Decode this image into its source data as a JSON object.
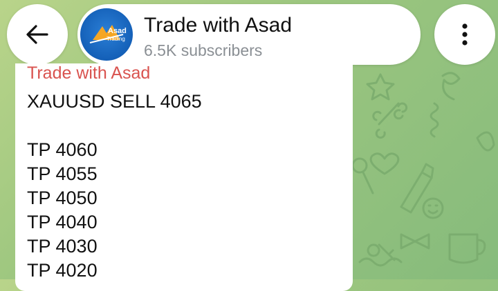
{
  "header": {
    "channel_name": "Trade with Asad",
    "subscribers": "6.5K subscribers",
    "back_icon": "arrow-left-icon",
    "menu_icon": "more-vertical-icon",
    "avatar": {
      "brand_line1": "Asad",
      "brand_line2": "Trading"
    }
  },
  "message": {
    "sender": "Trade with Asad",
    "lines": [
      "XAUUSD SELL 4065",
      "",
      "TP 4060",
      "TP 4055",
      "TP 4050",
      "TP 4040",
      "TP 4030",
      "TP 4020"
    ]
  },
  "colors": {
    "sender_name": "#d9534f",
    "wallpaper": "#9cc67f",
    "subtitle": "#8a8f94"
  }
}
